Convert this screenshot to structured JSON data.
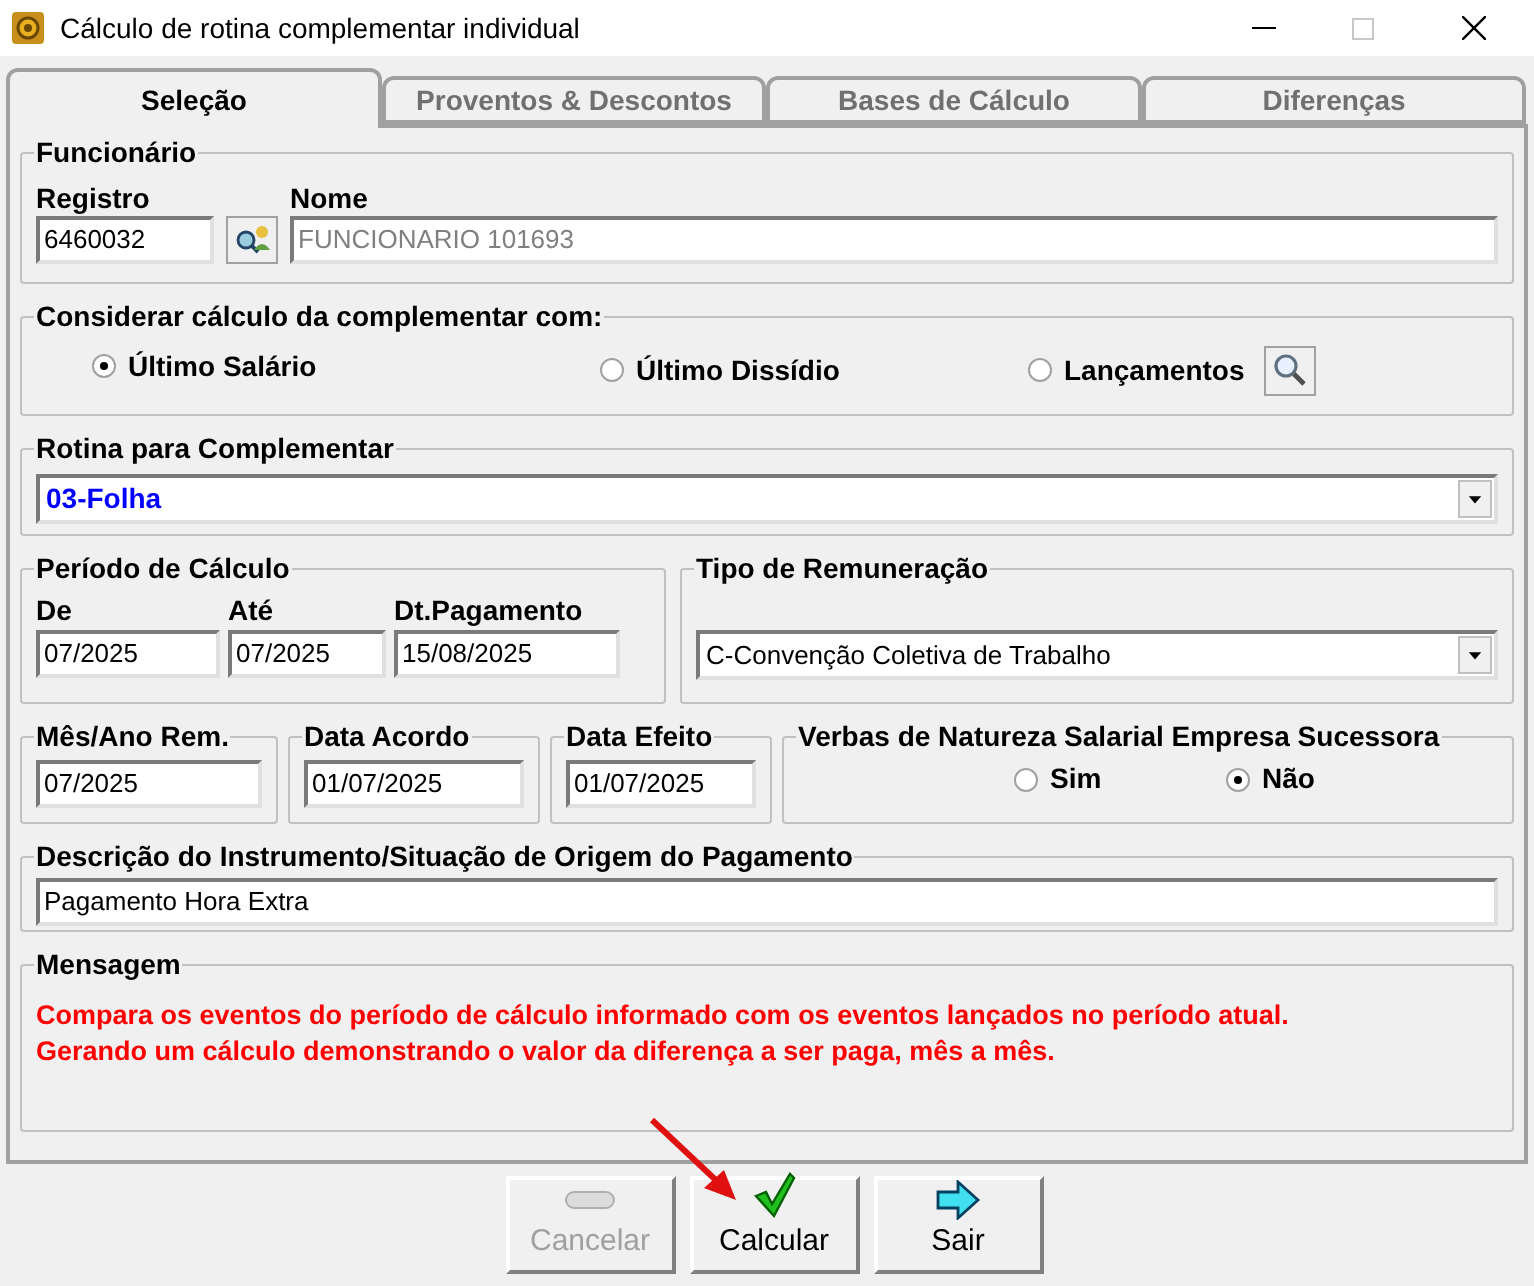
{
  "window": {
    "title": "Cálculo de rotina complementar individual"
  },
  "tabs": [
    {
      "label": "Seleção",
      "selected": true
    },
    {
      "label": "Proventos & Descontos",
      "selected": false
    },
    {
      "label": "Bases de Cálculo",
      "selected": false
    },
    {
      "label": "Diferenças",
      "selected": false
    }
  ],
  "funcionario": {
    "title": "Funcionário",
    "registro_label": "Registro",
    "registro_value": "6460032",
    "nome_label": "Nome",
    "nome_value": "FUNCIONARIO 101693",
    "nome_disabled": true
  },
  "considerar": {
    "title": "Considerar cálculo da complementar com:",
    "options": [
      {
        "label": "Último Salário",
        "selected": true
      },
      {
        "label": "Último Dissídio",
        "selected": false
      },
      {
        "label": "Lançamentos",
        "selected": false
      }
    ]
  },
  "rotina": {
    "title": "Rotina para Complementar",
    "value": "03-Folha"
  },
  "periodo": {
    "title": "Período de Cálculo",
    "fields": [
      {
        "label": "De",
        "value": "07/2025"
      },
      {
        "label": "Até",
        "value": "07/2025"
      },
      {
        "label": "Dt.Pagamento",
        "value": "15/08/2025"
      }
    ]
  },
  "tipo_remuneracao": {
    "title": "Tipo de Remuneração",
    "value": "C-Convenção Coletiva de Trabalho"
  },
  "datas": [
    {
      "title": "Mês/Ano Rem.",
      "value": "07/2025"
    },
    {
      "title": "Data Acordo",
      "value": "01/07/2025"
    },
    {
      "title": "Data Efeito",
      "value": "01/07/2025"
    }
  ],
  "verbas": {
    "title": "Verbas de Natureza Salarial Empresa Sucessora",
    "options": [
      {
        "label": "Sim",
        "selected": false
      },
      {
        "label": "Não",
        "selected": true
      }
    ]
  },
  "descricao": {
    "title": "Descrição do Instrumento/Situação de Origem do Pagamento",
    "value": "Pagamento Hora Extra"
  },
  "mensagem": {
    "title": "Mensagem",
    "lines": [
      "Compara os eventos do período de cálculo informado com os eventos lançados no período atual.",
      "Gerando um cálculo demonstrando o valor da diferença a ser paga, mês a mês."
    ]
  },
  "buttons": [
    {
      "kind": "cancel",
      "label": "Cancelar",
      "disabled": true
    },
    {
      "kind": "calculate",
      "label": "Calcular",
      "disabled": false
    },
    {
      "kind": "exit",
      "label": "Sair",
      "disabled": false
    }
  ]
}
